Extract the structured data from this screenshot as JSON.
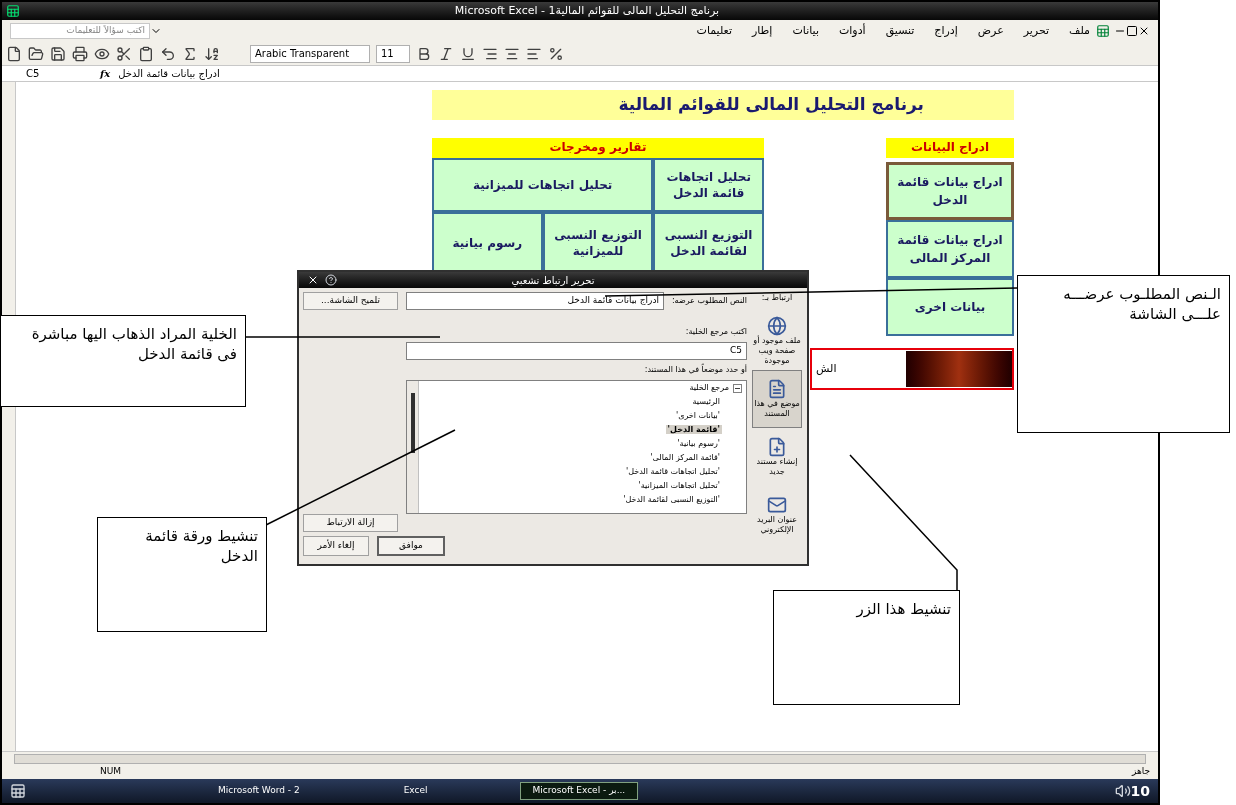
{
  "window": {
    "title": "Microsoft Excel - برنامج التحليل المالى للقوائم المالية1"
  },
  "menu_bar": {
    "help_box": {
      "placeholder": "اكتب سؤالاً للتعليمات"
    },
    "items": [
      "ملف",
      "تحرير",
      "عرض",
      "إدراج",
      "تنسيق",
      "أدوات",
      "بيانات",
      "إطار",
      "تعليمات"
    ]
  },
  "toolbar": {
    "font": "Arabic Transparent",
    "size": "11"
  },
  "formula_bar": {
    "name_box": "C5",
    "function_symbol": "fx",
    "formula": "ادراج بيانات قائمة الدخل"
  },
  "sheet": {
    "banner": "برنامج  التحليل المالى للقوائم المالية",
    "reports": {
      "header": "تقارير ومخرجات",
      "cells": [
        "تحليل اتجاهات قائمة الدخل",
        "تحليل اتجاهات للميزانية",
        "التوزيع النسبى لقائمة الدخل",
        "التوزيع النسبى للميزانية",
        "رسوم بيانية"
      ]
    },
    "data_entry": {
      "header": "ادراج البيانات",
      "cells": [
        {
          "label": "ادراج بيانات قائمة الدخل",
          "selected": true
        },
        {
          "label": "ادراج بيانات قائمة المركز المالى",
          "selected": false
        },
        {
          "label": "بيانات اخرى",
          "selected": false
        }
      ]
    },
    "note": "الش"
  },
  "dialog": {
    "title": "تحرير ارتباط تشعبي",
    "link_to_label": "ارتباط بـ:",
    "link_to": [
      {
        "label": "ملف موجود أو صفحة ويب موجودة",
        "kind": "globe",
        "selected": false
      },
      {
        "label": "موضع في هذا المستند",
        "kind": "place",
        "selected": true
      },
      {
        "label": "إنشاء مستند جديد",
        "kind": "new",
        "selected": false
      },
      {
        "label": "عنوان البريد الإلكتروني",
        "kind": "mail",
        "selected": false
      }
    ],
    "text_label": "النص المطلوب عرضه:",
    "text_value": "ادراج بيانات قائمة الدخل",
    "screentip_button": "تلميح الشاشة...",
    "cell_ref_label": "اكتب مرجع الخلية:",
    "cell_ref_value": "C5",
    "place_label": "أو حدد موضعاً في هذا المستند:",
    "tree": {
      "label": "مرجع الخلية",
      "expanded": true,
      "children": [
        {
          "label": "الرئيسية",
          "selected": false
        },
        {
          "label": "'بيانات اخرى'",
          "selected": false
        },
        {
          "label": "'قائمة الدخل'",
          "selected": true
        },
        {
          "label": "'رسوم بيانية'",
          "selected": false
        },
        {
          "label": "'قائمة المركز المالى'",
          "selected": false
        },
        {
          "label": "'تحليل اتجاهات قائمة الدخل'",
          "selected": false
        },
        {
          "label": "'تحليل اتجاهات الميزانية'",
          "selected": false
        },
        {
          "label": "'التوزيع النسبى لقائمة الدخل'",
          "selected": false
        }
      ]
    },
    "remove_link_button": "إزالة الارتباط",
    "ok_button": "موافق",
    "cancel_button": "إلغاء الأمر"
  },
  "callouts": [
    {
      "text": "الـنص المطلـوب عرضـــه علـــى الشاشة"
    },
    {
      "text": "الخلية المراد الذهاب اليها مباشرة فى قائمة الدخل"
    },
    {
      "text": "تنشيط ورقة قائمة الدخل"
    },
    {
      "text": "تنشيط هذا الزر"
    }
  ],
  "status_bar": {
    "mode": "جاهز",
    "num": "NUM"
  },
  "taskbar": {
    "items": [
      {
        "label": "Microsoft Excel - بر...",
        "selected": true
      },
      {
        "label": "Excel",
        "selected": false
      },
      {
        "label": "Microsoft Word - 2",
        "selected": false
      }
    ],
    "time": "10"
  }
}
